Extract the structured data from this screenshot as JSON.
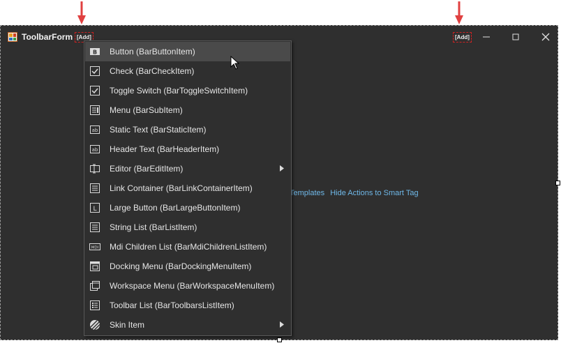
{
  "form": {
    "title": "ToolbarForm",
    "add_left_label": "[Add]",
    "add_right_label": "[Add]",
    "links": {
      "templates": "Templates",
      "hide_actions": "Hide Actions to Smart Tag"
    }
  },
  "menu": {
    "items": [
      {
        "label": "Button (BarButtonItem)",
        "icon": "button-icon"
      },
      {
        "label": "Check (BarCheckItem)",
        "icon": "checkbox-icon"
      },
      {
        "label": "Toggle Switch (BarToggleSwitchItem)",
        "icon": "checkbox-icon"
      },
      {
        "label": "Menu (BarSubItem)",
        "icon": "menu-icon"
      },
      {
        "label": "Static Text (BarStaticItem)",
        "icon": "text-ab-icon"
      },
      {
        "label": "Header Text (BarHeaderItem)",
        "icon": "text-ab-icon"
      },
      {
        "label": "Editor (BarEditItem)",
        "icon": "editor-icon"
      },
      {
        "label": "Link Container (BarLinkContainerItem)",
        "icon": "list-icon"
      },
      {
        "label": "Large Button (BarLargeButtonItem)",
        "icon": "large-button-icon"
      },
      {
        "label": "String List (BarListItem)",
        "icon": "list-icon"
      },
      {
        "label": "Mdi Children List (BarMdiChildrenListItem)",
        "icon": "mdi-icon"
      },
      {
        "label": "Docking Menu (BarDockingMenuItem)",
        "icon": "docking-icon"
      },
      {
        "label": "Workspace Menu (BarWorkspaceMenuItem)",
        "icon": "workspace-icon"
      },
      {
        "label": "Toolbar List (BarToolbarsListItem)",
        "icon": "toolbar-list-icon"
      },
      {
        "label": "Skin Item",
        "icon": "skin-icon"
      }
    ]
  },
  "colors": {
    "accent_arrow": "#e04040",
    "link": "#6fb8e8",
    "highlight": "#4a4a4a"
  }
}
